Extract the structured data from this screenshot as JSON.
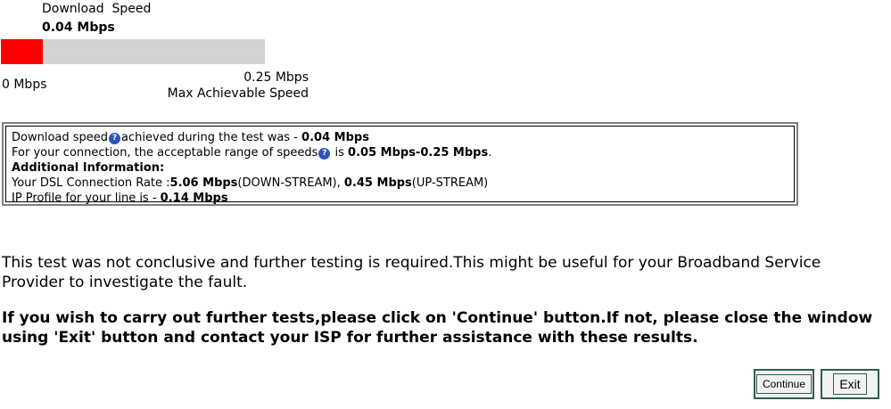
{
  "speed": {
    "title": "Download  Speed",
    "value": "0.04 Mbps",
    "fill_fraction": 0.16,
    "min_label": "0 Mbps",
    "max_value": "0.25 Mbps",
    "max_label": "Max Achievable Speed",
    "fill_color": "#ff0000",
    "track_color": "#d3d3d3"
  },
  "info": {
    "line1_pre": "Download speed",
    "line1_post": "achieved during the test was - ",
    "line1_value": "0.04 Mbps",
    "line2_pre": "For your connection, the acceptable range of speeds",
    "line2_mid": " is ",
    "line2_value": "0.05 Mbps-0.25 Mbps",
    "line2_end": ".",
    "additional": "Additional Information:",
    "line4_pre": "Your DSL Connection Rate :",
    "line4_down": "5.06 Mbps",
    "line4_down_label": "(DOWN-STREAM), ",
    "line4_up": "0.45 Mbps",
    "line4_up_label": "(UP-STREAM)",
    "line5_pre": "IP Profile for your line is - ",
    "line5_value": "0.14 Mbps",
    "help_glyph": "?"
  },
  "message": "This test was not conclusive and further testing is required.This might be useful for your Broadband Service Provider to investigate the fault.",
  "instruction": "If you wish to carry out further tests,please click on 'Continue' button.If not, please close the window using 'Exit' button and contact your ISP for further assistance with these results.",
  "buttons": {
    "continue": "Continue",
    "exit": "Exit"
  }
}
